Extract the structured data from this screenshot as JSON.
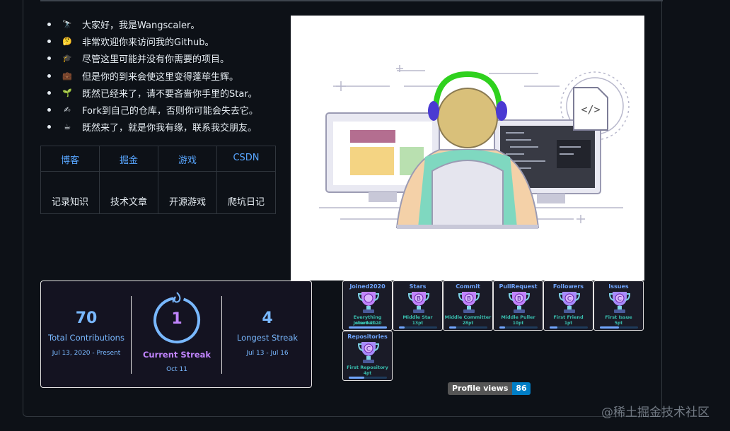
{
  "intro": [
    {
      "icon": "telescope-icon",
      "emoji": "🔭",
      "text": "大家好，我是Wangscaler。"
    },
    {
      "icon": "thinking-face-icon",
      "emoji": "🤔",
      "text": "非常欢迎你来访问我的Github。"
    },
    {
      "icon": "graduation-cap-icon",
      "emoji": "🎓",
      "text": "尽管这里可能并没有你需要的项目。"
    },
    {
      "icon": "briefcase-icon",
      "emoji": "💼",
      "text": "但是你的到来会使这里变得蓬荜生辉。"
    },
    {
      "icon": "seedling-icon",
      "emoji": "🌱",
      "text": "既然已经来了，请不要吝啬你手里的Star。"
    },
    {
      "icon": "writing-hand-icon",
      "emoji": "✍",
      "text": "Fork到自己的仓库，否则你可能会失去它。"
    },
    {
      "icon": "coffee-icon",
      "emoji": "☕",
      "text": "既然来了，就是你我有缘，联系我交朋友。"
    }
  ],
  "nav": {
    "links": [
      "博客",
      "掘金",
      "游戏",
      "CSDN"
    ],
    "descriptions": [
      "记录知识",
      "技术文章",
      "开源游戏",
      "爬坑日记"
    ]
  },
  "illustration": {
    "code_symbol": "</>"
  },
  "streak": {
    "total": "70",
    "total_label": "Total Contributions",
    "total_range": "Jul 13, 2020 - Present",
    "current": "1",
    "current_label": "Current Streak",
    "current_date": "Oct 11",
    "longest": "4",
    "longest_label": "Longest Streak",
    "longest_range": "Jul 13 - Jul 16",
    "colors": {
      "number": "#79b8ff",
      "current_label": "#c084fc",
      "ring": "#79b8ff",
      "fire": "#79b8ff"
    }
  },
  "trophies": [
    {
      "title": "Joined2020",
      "rank": "",
      "desc1": "Everything started...",
      "desc2": "Joined 2020",
      "progress": 1.0,
      "color": "#c084fc"
    },
    {
      "title": "Stars",
      "rank": "B",
      "desc1": "Middle Star",
      "desc2": "13pt",
      "progress": 0.15,
      "color": "#c084fc"
    },
    {
      "title": "Commit",
      "rank": "B",
      "desc1": "Middle Committer",
      "desc2": "28pt",
      "progress": 0.18,
      "color": "#c084fc"
    },
    {
      "title": "PullRequest",
      "rank": "B",
      "desc1": "Middle Puller",
      "desc2": "10pt",
      "progress": 0.15,
      "color": "#c084fc"
    },
    {
      "title": "Followers",
      "rank": "C",
      "desc1": "First Friend",
      "desc2": "1pt",
      "progress": 0.2,
      "color": "#a78bfa"
    },
    {
      "title": "Issues",
      "rank": "C",
      "desc1": "First Issue",
      "desc2": "5pt",
      "progress": 0.5,
      "color": "#a78bfa"
    },
    {
      "title": "Repositories",
      "rank": "C",
      "desc1": "First Repository",
      "desc2": "4pt",
      "progress": 0.4,
      "color": "#a78bfa"
    }
  ],
  "profile_views": {
    "label": "Profile views",
    "count": "86"
  },
  "watermark": "@稀土掘金技术社区"
}
